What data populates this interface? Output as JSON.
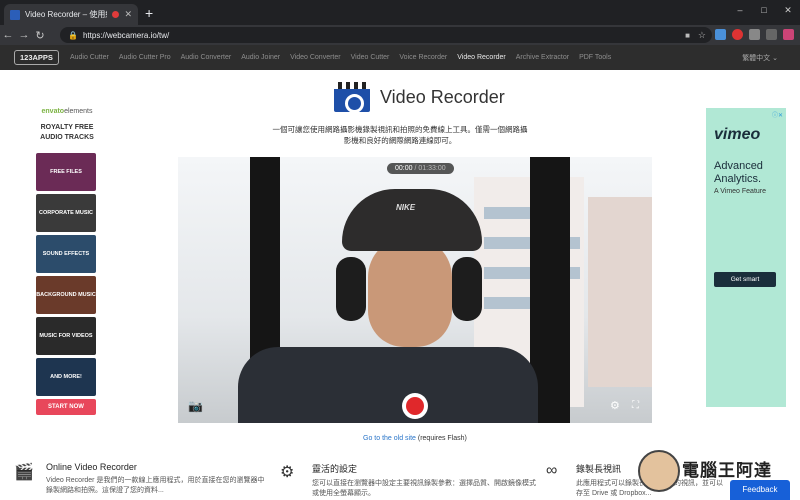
{
  "browser": {
    "tab_title": "Video Recorder – 使用網路...",
    "new_tab": "+",
    "url": "https://webcamera.io/tw/",
    "window_controls": [
      "–",
      "□",
      "✕"
    ]
  },
  "site": {
    "logo": "123APPS",
    "nav": [
      "Audio Cutter",
      "Audio Cutter Pro",
      "Audio Converter",
      "Audio Joiner",
      "Video Converter",
      "Video Cutter",
      "Voice Recorder",
      "Video Recorder",
      "Archive Extractor",
      "PDF Tools"
    ],
    "active_nav": "Video Recorder",
    "language": "繁體中文 ⌄"
  },
  "app": {
    "title": "Video Recorder",
    "description": "一個可讓您使用網路攝影機錄製視訊和拍照的免費線上工具。僅需一個網路攝影機和良好的網際網路連線即可。"
  },
  "video": {
    "elapsed": "00:00",
    "total": "/ 01:33:00",
    "cap_logo": "NIKE"
  },
  "old_site": {
    "link": "Go to the old site",
    "note": " (requires Flash)"
  },
  "left_ad": {
    "brand": "envato",
    "brand_suffix": "elements",
    "headline": "ROYALTY FREE AUDIO TRACKS",
    "tiles": [
      {
        "label": "FREE FILES",
        "color": "#6b2b56"
      },
      {
        "label": "CORPORATE MUSIC",
        "color": "#3a3a3a"
      },
      {
        "label": "SOUND EFFECTS",
        "color": "#2c4c6b"
      },
      {
        "label": "BACKGROUND MUSIC",
        "color": "#6a3a2a"
      },
      {
        "label": "MUSIC FOR VIDEOS",
        "color": "#2a2a2a"
      },
      {
        "label": "AND MORE!",
        "color": "#1e3550"
      }
    ],
    "cta": "START NOW"
  },
  "right_ad": {
    "brand": "vimeo",
    "headline": "Advanced Analytics.",
    "sub": "A Vimeo Feature",
    "cta": "Get smart"
  },
  "features": [
    {
      "title": "Online Video Recorder",
      "text": "Video Recorder 是我們的一款線上應用程式，用於直接在您的瀏覽器中錄製網路和拍照。這保證了您的資料..."
    },
    {
      "title": "靈活的設定",
      "text": "您可以直接在瀏覽器中設定主要視訊錄製參數：選擇品質、開啟鏡像模式或使用全螢幕顯示。"
    },
    {
      "title": "錄製長視訊",
      "text": "此應用程式可以錄製長達一小時的視訊，並可以存至 Drive 或 Dropbox..."
    }
  ],
  "watermark": "電腦王阿達",
  "feedback": "Feedback",
  "colors": {
    "accent": "#e0282b",
    "link": "#2a75c9",
    "right_ad_bg": "#b1e8d5",
    "feedback": "#1760d8"
  }
}
